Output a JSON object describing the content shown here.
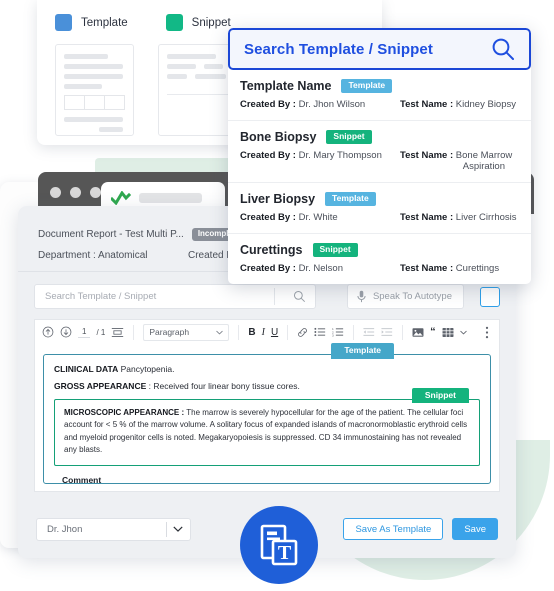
{
  "legend": {
    "items": [
      {
        "label": "Template",
        "color": "#4a90d9"
      },
      {
        "label": "Snippet",
        "color": "#12b886"
      }
    ]
  },
  "search_panel": {
    "search_label": "Search Template / Snippet",
    "search_icon": "search-icon",
    "results": [
      {
        "title": "Template Name",
        "badge": "Template",
        "badge_type": "template",
        "created_by_label": "Created By",
        "created_by": "Dr. Jhon Wilson",
        "test_name_label": "Test Name",
        "test_name": "Kidney Biopsy",
        "test_name_line2": ""
      },
      {
        "title": "Bone Biopsy",
        "badge": "Snippet",
        "badge_type": "snippet",
        "created_by_label": "Created By",
        "created_by": "Dr. Mary Thompson",
        "test_name_label": "Test Name",
        "test_name": "Bone Marrow",
        "test_name_line2": "Aspiration"
      },
      {
        "title": "Liver Biopsy",
        "badge": "Template",
        "badge_type": "template",
        "created_by_label": "Created By",
        "created_by": "Dr. White",
        "test_name_label": "Test Name",
        "test_name": "Liver Cirrhosis",
        "test_name_line2": ""
      },
      {
        "title": "Curettings",
        "badge": "Snippet",
        "badge_type": "snippet",
        "created_by_label": "Created By",
        "created_by": "Dr. Nelson",
        "test_name_label": "Test Name",
        "test_name": "Curettings",
        "test_name_line2": ""
      }
    ]
  },
  "app": {
    "doc_title": "Document Report - Test Multi P...",
    "status_badge": "Incompleted",
    "department_line": "Department : Anatomical",
    "created_by_line": "Created By : M",
    "search": {
      "placeholder": "Search Template / Snippet",
      "icon": "search-icon"
    },
    "autotype": {
      "label": "Speak To Autotype",
      "icon": "microphone-icon"
    },
    "toolbar": {
      "page_current": "1",
      "page_total": "/ 1",
      "paragraph_label": "Paragraph",
      "icons": [
        "page-up-icon",
        "page-down-icon",
        "page-break-icon",
        "bold-icon",
        "italic-icon",
        "underline-icon",
        "link-icon",
        "bullet-list-icon",
        "numbered-list-icon",
        "outdent-icon",
        "indent-icon",
        "image-icon",
        "quote-icon",
        "table-icon",
        "more-options-icon"
      ]
    },
    "editor": {
      "template_badge": "Template",
      "snippet_badge": "Snippet",
      "line1_bold": "CLINICAL DATA",
      "line1_rest": " Pancytopenia.",
      "line2_bold": "GROSS APPEARANCE",
      "line2_rest": " : Received four linear bony tissue cores.",
      "snippet_bold": "MICROSCOPIC APPEARANCE :",
      "snippet_text": " The marrow is severely hypocellular for the age of the patient. The cellular foci account for < 5 % of the marrow volume. A solitary focus of expanded islands of macronormoblastic erythroid cells and myeloid progenitor cells is noted. Megakaryopoiesis is suppressed. CD 34 immunostaining has not revealed any blasts.",
      "comment_label": "Comment"
    },
    "footer": {
      "doctor_select_value": "Dr. Jhon",
      "save_as_template_label": "Save As Template",
      "save_label": "Save",
      "chevron_icon": "chevron-down-icon"
    }
  },
  "logo": {
    "icon": "document-text-logo-icon",
    "color": "#1f5fd8"
  },
  "colors": {
    "template": "#4a90d9",
    "snippet": "#12b886",
    "accent_blue": "#3aa3ea",
    "search_blue": "#1f4fe0"
  }
}
